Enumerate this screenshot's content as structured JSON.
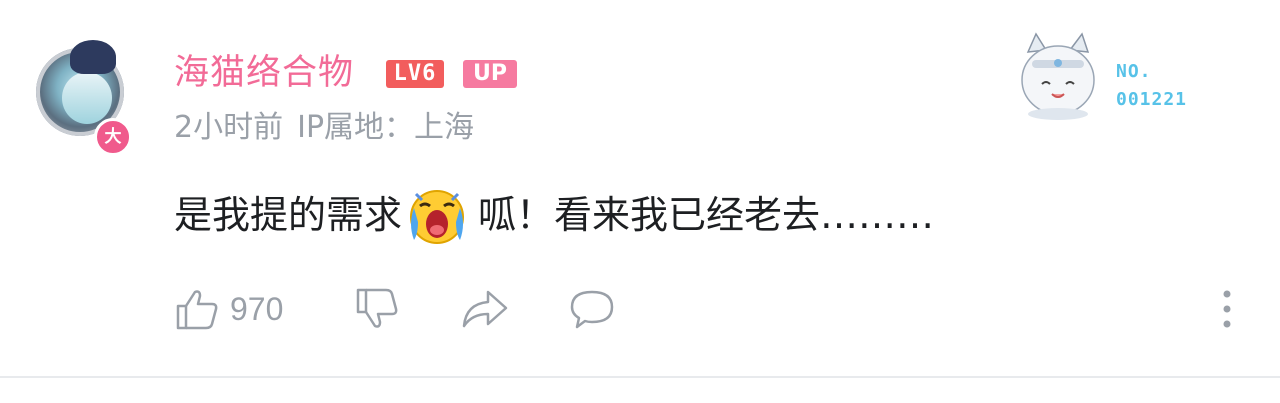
{
  "comment": {
    "username": "海猫络合物",
    "level_badge": "LV6",
    "up_badge": "UP",
    "avatar_badge": "大",
    "time": "2小时前",
    "ip_location": "IP属地：上海",
    "content_before_emoji": "是我提的需求",
    "emoji": "crying-emoji",
    "content_after_emoji": "呱！看来我已经老去………",
    "fan_badge": {
      "line1": "NO.",
      "line2": "001221"
    },
    "actions": {
      "like_count": "970"
    }
  },
  "colors": {
    "username": "#f26b97",
    "level_badge": "#f25d5d",
    "up_badge": "#f67aa0",
    "meta_text": "#9aa0a8",
    "fan_badge_text": "#57c2e8",
    "content_text": "#1d1f22"
  },
  "icons": [
    "like-icon",
    "dislike-icon",
    "share-icon",
    "reply-icon",
    "more-icon"
  ]
}
